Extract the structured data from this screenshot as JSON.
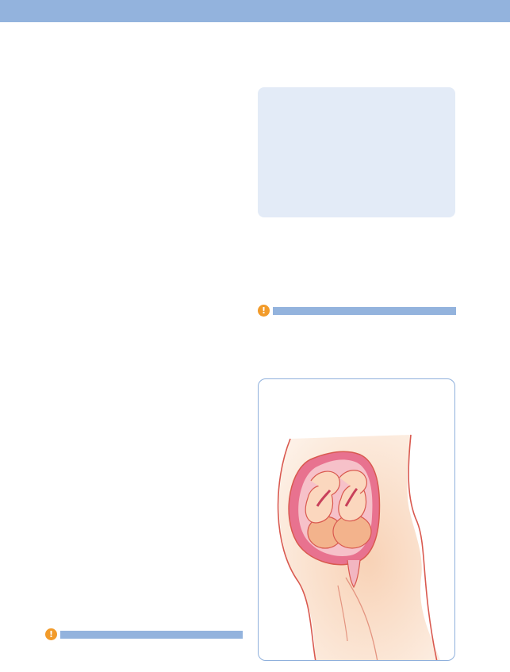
{
  "page": {
    "header_band": "",
    "info_box": "",
    "notes": [
      {
        "icon": "exclamation-icon",
        "glyph": "!"
      },
      {
        "icon": "exclamation-icon",
        "glyph": "!"
      }
    ],
    "figure": {
      "subject": "twins-in-uterus-illustration",
      "colors": {
        "skin": "#fbdcc4",
        "uterus": "#e8728f",
        "outline": "#d9594f",
        "frame": "#8fb0dc"
      }
    }
  }
}
